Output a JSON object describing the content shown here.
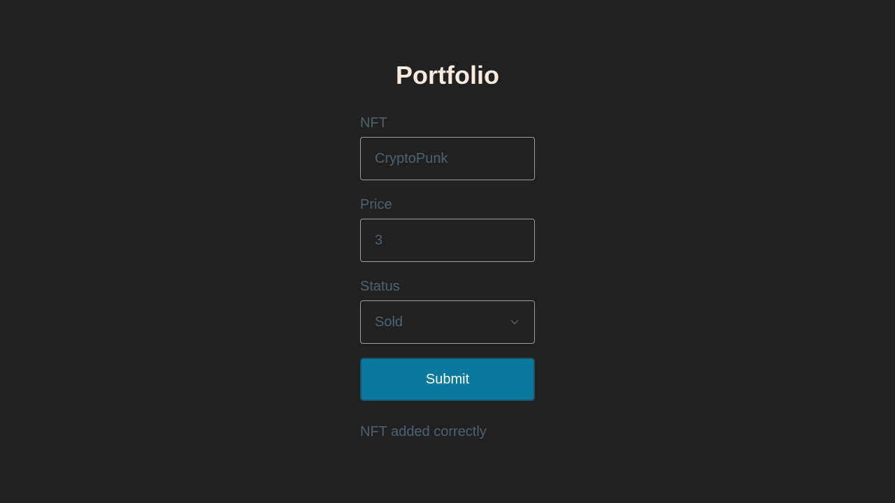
{
  "page": {
    "title": "Portfolio"
  },
  "form": {
    "nft": {
      "label": "NFT",
      "placeholder": "CryptoPunk",
      "value": ""
    },
    "price": {
      "label": "Price",
      "placeholder": "3",
      "value": ""
    },
    "status": {
      "label": "Status",
      "selected": "Sold",
      "icon": "chevron-down-icon"
    },
    "submit_label": "Submit"
  },
  "message": "NFT added correctly",
  "colors": {
    "background": "#212121",
    "title": "#fcebdc",
    "muted_text": "#4c6373",
    "field_border": "#9e9e9e",
    "accent": "#0a799f"
  }
}
